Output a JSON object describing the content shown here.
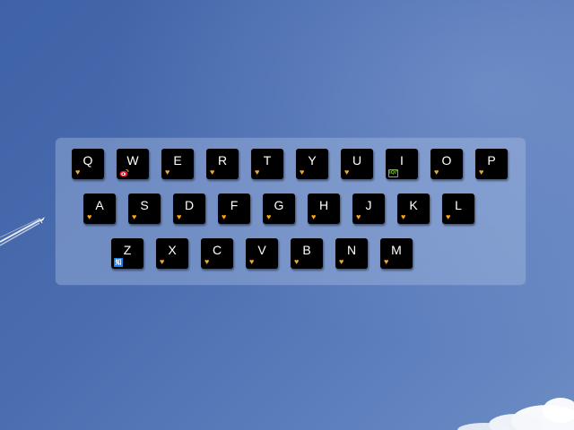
{
  "background": {
    "description_color": "#4a6db0"
  },
  "keyboard": {
    "row1": [
      {
        "letter": "Q",
        "badge": "heart-icon"
      },
      {
        "letter": "W",
        "badge": "weibo-icon"
      },
      {
        "letter": "E",
        "badge": "heart-icon"
      },
      {
        "letter": "R",
        "badge": "heart-icon"
      },
      {
        "letter": "T",
        "badge": "heart-icon"
      },
      {
        "letter": "Y",
        "badge": "heart-icon"
      },
      {
        "letter": "U",
        "badge": "heart-icon"
      },
      {
        "letter": "I",
        "badge": "iqiyi-icon",
        "badge_text": "iQIYI"
      },
      {
        "letter": "O",
        "badge": "heart-icon"
      },
      {
        "letter": "P",
        "badge": "heart-icon"
      }
    ],
    "row2": [
      {
        "letter": "A",
        "badge": "heart-icon"
      },
      {
        "letter": "S",
        "badge": "heart-icon"
      },
      {
        "letter": "D",
        "badge": "heart-icon"
      },
      {
        "letter": "F",
        "badge": "heart-icon"
      },
      {
        "letter": "G",
        "badge": "heart-icon"
      },
      {
        "letter": "H",
        "badge": "heart-icon"
      },
      {
        "letter": "J",
        "badge": "heart-icon"
      },
      {
        "letter": "K",
        "badge": "heart-icon"
      },
      {
        "letter": "L",
        "badge": "heart-icon"
      }
    ],
    "row3": [
      {
        "letter": "Z",
        "badge": "zhihu-icon",
        "badge_text": "知"
      },
      {
        "letter": "X",
        "badge": "heart-icon"
      },
      {
        "letter": "C",
        "badge": "heart-icon"
      },
      {
        "letter": "V",
        "badge": "heart-icon"
      },
      {
        "letter": "B",
        "badge": "heart-icon"
      },
      {
        "letter": "N",
        "badge": "heart-icon"
      },
      {
        "letter": "M",
        "badge": "heart-icon"
      }
    ],
    "heart_color": "#f5a623",
    "key_color": "#000000",
    "letter_color": "#ffffff"
  }
}
